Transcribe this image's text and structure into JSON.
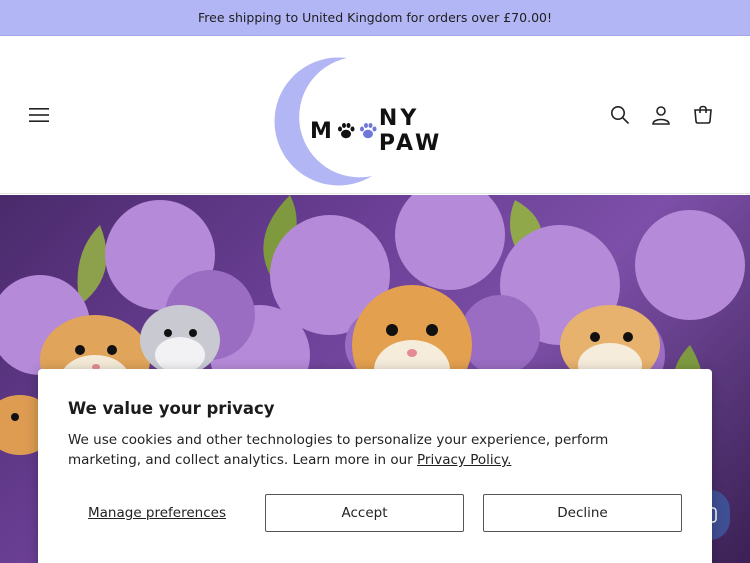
{
  "announcement": {
    "text": "Free shipping to United Kingdom for orders over £70.00!"
  },
  "header": {
    "logo": {
      "text_left": "M",
      "text_right": "NY PAW",
      "moon_color": "#b3b6f5"
    },
    "icons": [
      "menu-icon",
      "search-icon",
      "account-icon",
      "cart-icon"
    ]
  },
  "hero": {
    "image_alt_icon": "hamsters-lilac-image"
  },
  "cookie_banner": {
    "title": "We value your privacy",
    "body": "We use cookies and other technologies to personalize your experience, perform marketing, and collect analytics. Learn more in our ",
    "policy_link": "Privacy Policy.",
    "manage_label": "Manage preferences",
    "accept_label": "Accept",
    "decline_label": "Decline"
  },
  "colors": {
    "announcement_bg": "#b3b6f5",
    "brand": "#b3b6f5",
    "chat": "#3f4f93"
  }
}
